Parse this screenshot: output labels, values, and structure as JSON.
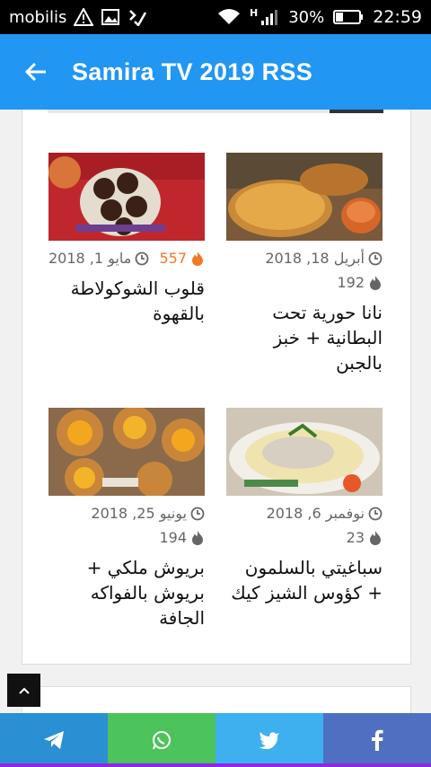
{
  "statusbar": {
    "carrier": "mobilis",
    "battery": "30%",
    "time": "22:59",
    "network": "H"
  },
  "appbar": {
    "title": "Samira TV 2019 RSS"
  },
  "posts": [
    {
      "title": "نانا حورية تحت البطانية + خبز بالجبن",
      "date": "أبريل 18, 2018",
      "views": "192",
      "views_hot": false
    },
    {
      "title": "قلوب الشوكولاطة بالقهوة",
      "date": "مايو 1, 2018",
      "views": "557",
      "views_hot": true
    },
    {
      "title": "سباغيتي بالسلمون + كؤوس الشيز كيك",
      "date": "نوفمبر 6, 2018",
      "views": "23",
      "views_hot": false
    },
    {
      "title": "بريوش ملكي + بريوش بالفواكه الجافة",
      "date": "يونيو 25, 2018",
      "views": "194",
      "views_hot": false
    }
  ],
  "share": {
    "telegram": "telegram-icon",
    "whatsapp": "whatsapp-icon",
    "twitter": "twitter-icon",
    "facebook": "facebook-icon"
  },
  "colors": {
    "appbar": "#2196f3",
    "hot": "#ef7a22",
    "telegram": "#2a8fd3",
    "whatsapp": "#4cc35b",
    "twitter": "#3eb0ef",
    "facebook": "#4f6fc0"
  }
}
